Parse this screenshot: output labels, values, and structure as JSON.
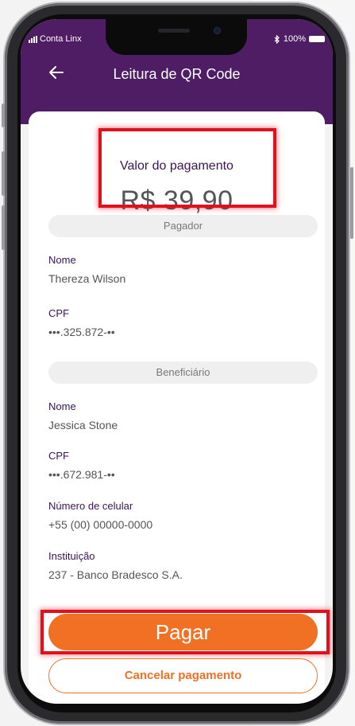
{
  "status_bar": {
    "carrier": "Conta Linx",
    "battery": "100%",
    "bluetooth_icon": "bluetooth-icon"
  },
  "header": {
    "title": "Leitura de QR Code",
    "back_icon": "arrow-left-icon",
    "background_color": "#4e1d63"
  },
  "payment": {
    "amount_label": "Valor do pagamento",
    "amount": "R$ 39,90"
  },
  "payer": {
    "section_title": "Pagador",
    "name_label": "Nome",
    "name": "Thereza Wilson",
    "cpf_label": "CPF",
    "cpf": "•••.325.872-••"
  },
  "beneficiary": {
    "section_title": "Beneficiário",
    "name_label": "Nome",
    "name": "Jessica Stone",
    "cpf_label": "CPF",
    "cpf": "•••.672.981-••",
    "phone_label": "Número de celular",
    "phone": "+55 (00) 00000-0000",
    "institution_label": "Instituição",
    "institution": "237 - Banco Bradesco S.A."
  },
  "actions": {
    "pay_label": "Pagar",
    "cancel_label": "Cancelar pagamento",
    "accent_color": "#f07024",
    "highlight_color": "#e0101c"
  }
}
